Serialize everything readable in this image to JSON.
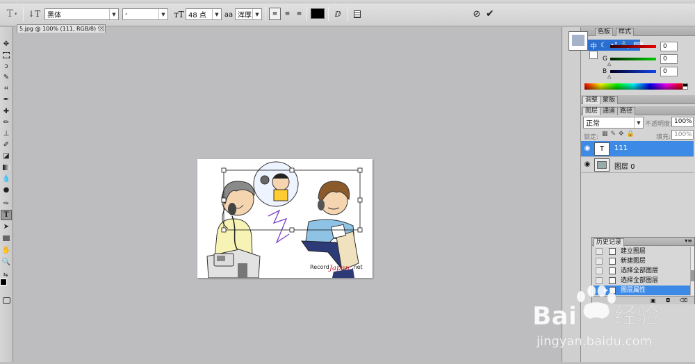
{
  "options_bar": {
    "font_family": "黑体",
    "font_style": "-",
    "font_size": "48 点",
    "antialias_label": "aa",
    "antialias": "浑厚",
    "text_color": "#000000"
  },
  "document_tab": {
    "title": "5.jpg @ 100% (111, RGB/8) *",
    "close": "×"
  },
  "artwork": {
    "watermark_small": "Record",
    "watermark_site": "Japan",
    "watermark_tld": ".net"
  },
  "color_panel": {
    "tabs": [
      "色板",
      "样式"
    ],
    "channels": [
      {
        "name": "",
        "value": "0",
        "color": "#cc0000"
      },
      {
        "name": "G",
        "value": "0",
        "color": "#00aa00"
      },
      {
        "name": "B",
        "value": "0",
        "color": "#1144cc"
      }
    ]
  },
  "ime_toolbar": {
    "mode": "中"
  },
  "adjust_panel": {
    "tabs": [
      "调整",
      "蒙版"
    ]
  },
  "layers_panel": {
    "tabs": [
      "图层",
      "通道",
      "路径"
    ],
    "blend_mode": "正常",
    "opacity_label": "不透明度:",
    "opacity": "100%",
    "lock_label": "锁定:",
    "fill_label": "填充:",
    "fill": "100%",
    "layers": [
      {
        "name": "111",
        "thumb": "T",
        "selected": true
      },
      {
        "name": "图层 0",
        "thumb": "",
        "selected": false
      }
    ]
  },
  "history_panel": {
    "title": "历史记录",
    "items": [
      {
        "label": "建立图层",
        "selected": false
      },
      {
        "label": "新建图层",
        "selected": false
      },
      {
        "label": "选择全部图层",
        "selected": false
      },
      {
        "label": "选择全部图层",
        "selected": false
      },
      {
        "label": "图层属性",
        "selected": true
      }
    ]
  },
  "watermark": {
    "brand_1": "Bai",
    "brand_2": "经验",
    "url": "jingyan.baidu.com"
  }
}
